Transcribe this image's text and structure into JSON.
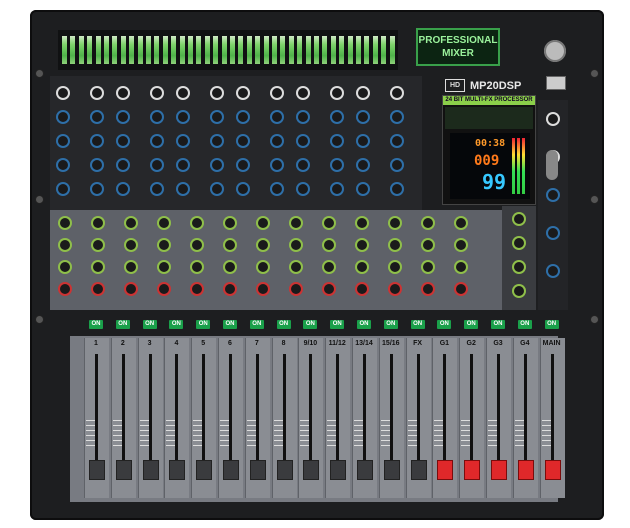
{
  "device": {
    "brand_box_line1": "PROFESSIONAL",
    "brand_box_line2": "MIXER",
    "logo": "HD",
    "model": "MP20DSP",
    "dsp_header": "24 BIT MULTI-FX PROCESSOR",
    "lcd_time": "00:38",
    "lcd_effect": "009",
    "lcd_preset": "99"
  },
  "channels": [
    {
      "label": "1",
      "on": "ON"
    },
    {
      "label": "2",
      "on": "ON"
    },
    {
      "label": "3",
      "on": "ON"
    },
    {
      "label": "4",
      "on": "ON"
    },
    {
      "label": "5",
      "on": "ON"
    },
    {
      "label": "6",
      "on": "ON"
    },
    {
      "label": "7",
      "on": "ON"
    },
    {
      "label": "8",
      "on": "ON"
    },
    {
      "label": "9/10",
      "on": "ON"
    },
    {
      "label": "11/12",
      "on": "ON"
    },
    {
      "label": "13/14",
      "on": "ON"
    },
    {
      "label": "15/16",
      "on": "ON"
    },
    {
      "label": "FX",
      "on": "ON"
    },
    {
      "label": "G1",
      "on": "ON"
    },
    {
      "label": "G2",
      "on": "ON"
    },
    {
      "label": "G3",
      "on": "ON"
    },
    {
      "label": "G4",
      "on": "ON"
    },
    {
      "label": "MAIN",
      "on": "ON"
    }
  ],
  "colors": {
    "body": "#1d1e20",
    "meter_green": "#7fd36b",
    "lcd_orange": "#ff9a2a",
    "lcd_blue": "#36c8ff",
    "on_button": "#1aa04a",
    "master_fader": "#e0282a"
  }
}
